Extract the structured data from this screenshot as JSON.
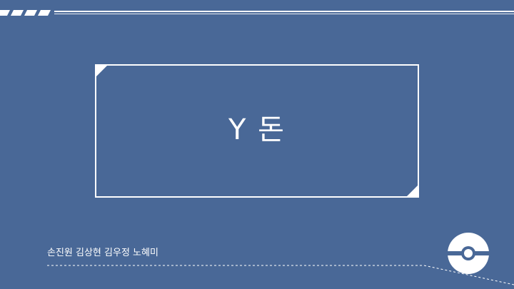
{
  "slide": {
    "title": "Y 돈",
    "authors": "손진원 김상현 김우정 노혜미"
  },
  "colors": {
    "background": "#496897",
    "foreground": "#ffffff"
  },
  "icons": {
    "decor": "pokeball-icon"
  }
}
